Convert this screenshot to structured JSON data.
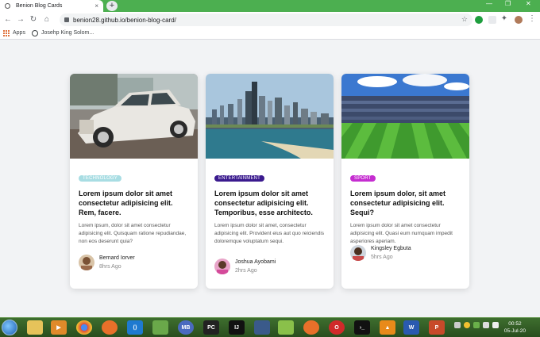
{
  "browser": {
    "tab_title": "Benion Blog Cards",
    "tab_close": "×",
    "new_tab": "+",
    "url": "benion28.github.io/benion-blog-card/",
    "bookmark_apps": "Apps",
    "bookmark_1": "Josehp King Solom..."
  },
  "cards": [
    {
      "tag": "TECHNOLOGY",
      "tag_color": "#a8dde3",
      "tag_text_color": "#ffffff",
      "title": "Lorem ipsum dolor sit amet consectetur adipisicing elit. Rem, facere.",
      "text": "Lorem ipsum, dolor sit amet consectetur adipisicing elit. Quisquam ratione repudiandae, non eos deserunt quia?",
      "author": "Bernard Iorver",
      "time": "8hrs Ago"
    },
    {
      "tag": "ENTERTAINMENT",
      "tag_color": "#3a1a8e",
      "tag_text_color": "#ffffff",
      "title": "Lorem ipsum dolor sit amet consectetur adipisicing elit. Temporibus, esse architecto.",
      "text": "Lorem ipsum dolor sit amet, consectetur adipisicing elit. Provident eius aut quo reiciendis doloremque voluptatum sequi.",
      "author": "Joshua Ayobami",
      "time": "2hrs Ago"
    },
    {
      "tag": "SPORT",
      "tag_color": "#c52dd0",
      "tag_text_color": "#ffffff",
      "title": "Lorem ipsum dolor, sit amet consectetur adipisicing elit. Sequi?",
      "text": "Lorem ipsum dolor sit amet consectetur adipisicing elit. Quasi eum numquam impedit asperiores aperiam.",
      "author": "Kingsley Egbuta",
      "time": "5hrs Ago"
    }
  ],
  "taskbar": {
    "icons": [
      "explorer-icon",
      "media-player-icon",
      "chrome-icon",
      "firefox-icon",
      "vscode-icon",
      "notepad-icon",
      "mb-icon",
      "pycharm-icon",
      "intellij-icon",
      "app-icon",
      "app-icon",
      "app-icon",
      "opera-icon",
      "cmd-icon",
      "vlc-icon",
      "word-icon",
      "powerpoint-icon"
    ],
    "mb_label": "MB",
    "pc_label": "PC",
    "ij_label": "IJ",
    "w_label": "W",
    "p_label": "P",
    "time": "00:52",
    "date": "05-Jul-20"
  }
}
